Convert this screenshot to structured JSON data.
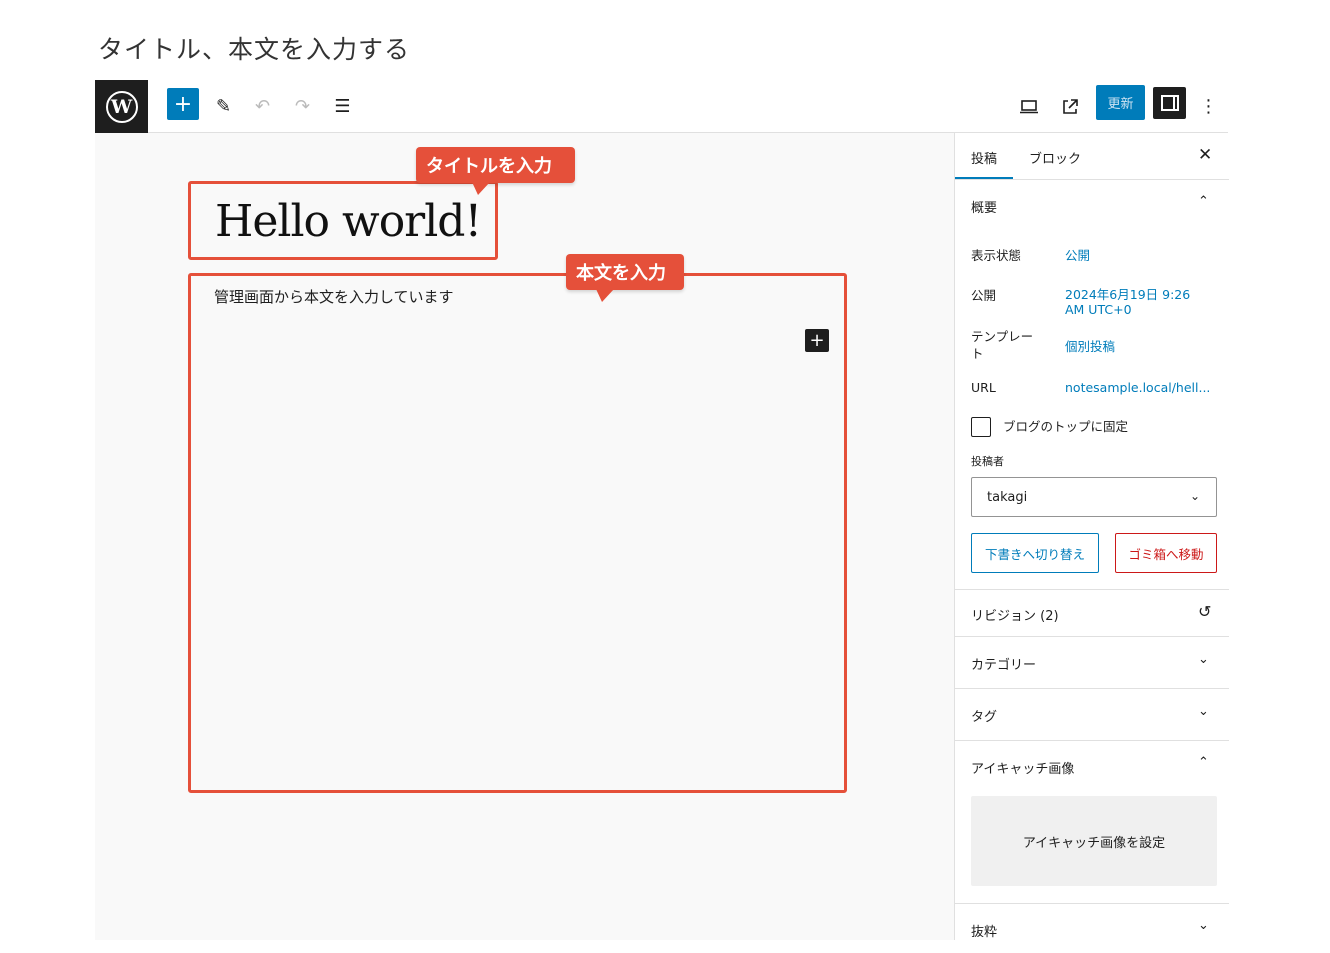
{
  "page_heading": "タイトル、本文を入力する",
  "toolbar": {
    "wp_logo": "W",
    "add_icon": "+",
    "edit_icon": "✎",
    "undo_icon": "↶",
    "redo_icon": "↷",
    "list_icon": "☰",
    "update_label": "更新",
    "more_icon": "⋮"
  },
  "canvas": {
    "title": "Hello world!",
    "body_text": "管理画面から本文を入力しています",
    "inserter_icon": "+",
    "callout_title": "タイトルを入力",
    "callout_body": "本文を入力"
  },
  "sidebar": {
    "tabs": [
      "投稿",
      "ブロック"
    ],
    "close_icon": "✕",
    "summary_label": "概要",
    "rows": [
      {
        "label": "表示状態",
        "value": "公開"
      },
      {
        "label": "公開",
        "value": "2024年6月19日 9:26 AM UTC+0"
      },
      {
        "label": "テンプレート",
        "value": "個別投稿"
      },
      {
        "label": "URL",
        "value": "notesample.local/hell..."
      }
    ],
    "sticky_label": "ブログのトップに固定",
    "author_label": "投稿者",
    "author_value": "takagi",
    "draft_button": "下書きへ切り替え",
    "trash_button": "ゴミ箱へ移動",
    "revisions_label": "リビジョン (2)",
    "categories_label": "カテゴリー",
    "tags_label": "タグ",
    "featured_label": "アイキャッチ画像",
    "featured_button": "アイキャッチ画像を設定",
    "excerpt_label": "抜粋"
  }
}
